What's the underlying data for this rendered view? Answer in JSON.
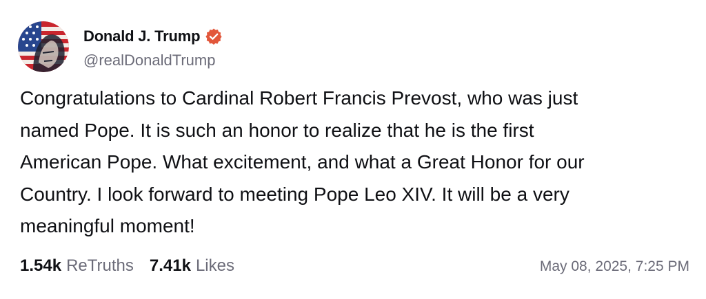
{
  "author": {
    "display_name": "Donald J. Trump",
    "handle": "@realDonaldTrump",
    "verified_icon": "verified-badge-icon",
    "verified_color": "#e2573b",
    "avatar_icon": "avatar-flag-portrait"
  },
  "post": {
    "text": "Congratulations to Cardinal Robert Francis Prevost, who was just\nnamed Pope. It is such an honor to realize that he is the first\nAmerican Pope. What excitement, and what a Great Honor for our\nCountry. I look forward to meeting Pope Leo XIV. It will be a very\nmeaningful moment!"
  },
  "stats": {
    "retruths_count": "1.54k",
    "retruths_label": "ReTruths",
    "likes_count": "7.41k",
    "likes_label": "Likes"
  },
  "timestamp": "May 08, 2025, 7:25 PM"
}
